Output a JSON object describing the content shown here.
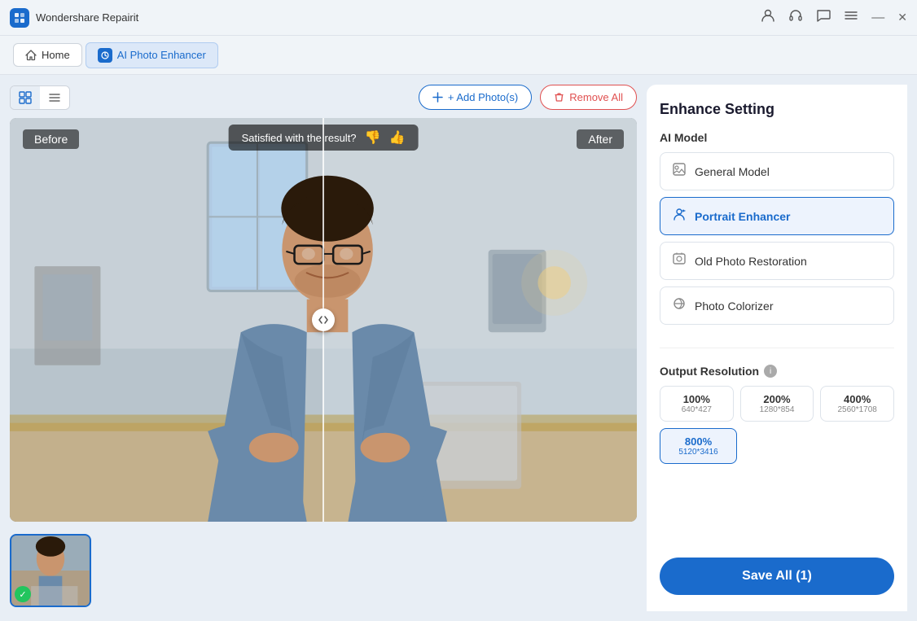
{
  "app": {
    "name": "Wondershare Repairit",
    "icon": "W"
  },
  "titlebar": {
    "icons": [
      "account-icon",
      "headphones-icon",
      "chat-icon",
      "menu-icon",
      "minimize-icon",
      "close-icon"
    ]
  },
  "nav": {
    "home_label": "Home",
    "active_tab_label": "AI Photo Enhancer"
  },
  "toolbar": {
    "grid_view_label": "⊞",
    "list_view_label": "≡",
    "add_photos_label": "+ Add Photo(s)",
    "remove_all_label": "🗑 Remove All"
  },
  "comparison": {
    "before_label": "Before",
    "after_label": "After",
    "satisfaction_text": "Satisfied with the result?",
    "divider_handle": "◁▷"
  },
  "right_panel": {
    "title": "Enhance Setting",
    "ai_model_section": "AI Model",
    "models": [
      {
        "id": "general",
        "label": "General Model",
        "active": false
      },
      {
        "id": "portrait",
        "label": "Portrait Enhancer",
        "active": true
      },
      {
        "id": "oldphoto",
        "label": "Old Photo Restoration",
        "active": false
      },
      {
        "id": "colorizer",
        "label": "Photo Colorizer",
        "active": false
      }
    ],
    "output_resolution_label": "Output Resolution",
    "resolutions": [
      {
        "pct": "100%",
        "size": "640*427",
        "active": false
      },
      {
        "pct": "200%",
        "size": "1280*854",
        "active": false
      },
      {
        "pct": "400%",
        "size": "2560*1708",
        "active": false
      },
      {
        "pct": "800%",
        "size": "5120*3416",
        "active": true
      }
    ],
    "save_button_label": "Save All (1)"
  }
}
